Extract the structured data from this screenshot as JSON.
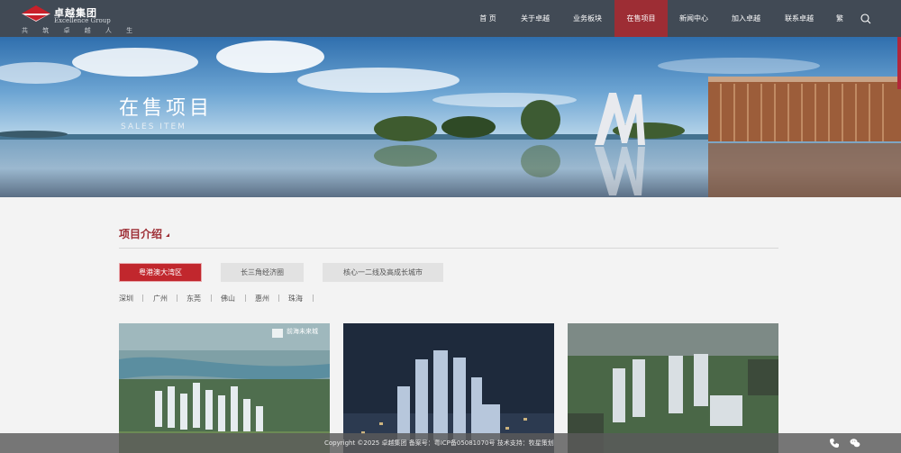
{
  "brand": {
    "name_cn": "卓越集团",
    "name_en": "Excellence Group",
    "slogan": "共 筑 卓 越 人 生"
  },
  "nav": {
    "items": [
      {
        "label": "首 页"
      },
      {
        "label": "关于卓越"
      },
      {
        "label": "业务板块"
      },
      {
        "label": "在售项目",
        "active": true
      },
      {
        "label": "新闻中心"
      },
      {
        "label": "加入卓越"
      },
      {
        "label": "联系卓越"
      },
      {
        "label": "繁"
      }
    ],
    "search_icon": "search-icon"
  },
  "banner": {
    "title": "在售项目",
    "subtitle": "SALES ITEM"
  },
  "intro": {
    "title": "项目介绍"
  },
  "regions": [
    {
      "label": "粤港澳大湾区",
      "active": true
    },
    {
      "label": "长三角经济圈",
      "active": false
    },
    {
      "label": "核心一二线及高成长城市",
      "active": false
    }
  ],
  "cities": [
    "深圳",
    "广州",
    "东莞",
    "佛山",
    "惠州",
    "珠海"
  ],
  "cards": [
    {
      "overlay_text": "前海未来城",
      "image": "aerial-rendering-riverside-towers"
    },
    {
      "image": "night-rendering-high-rise-towers"
    },
    {
      "image": "aerial-rendering-urban-towers"
    }
  ],
  "footer": {
    "text": "Copyright ©2025 卓越集团 备案号：粤ICP备05081070号   技术支持：牧星策划",
    "icons": [
      "phone-icon",
      "wechat-icon"
    ]
  },
  "colors": {
    "header_bg": "#414a55",
    "accent": "#9d2d34",
    "tab_active": "#c1272d"
  }
}
